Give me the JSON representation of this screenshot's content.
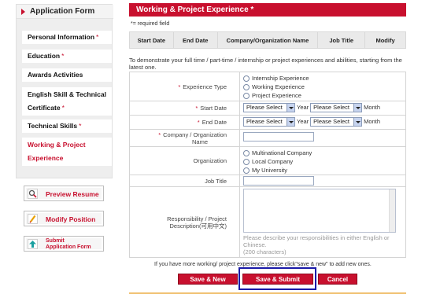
{
  "sidebar": {
    "title": "Application Form",
    "items": [
      {
        "label": "Personal Information",
        "required": "*"
      },
      {
        "label": "Education",
        "required": "*"
      },
      {
        "label": "Awards Activities",
        "required": ""
      },
      {
        "label_line1": "English Skill & Technical",
        "label_line2": "Certificate",
        "required": "*"
      },
      {
        "label": "Technical Skills",
        "required": "*"
      },
      {
        "label_line1": "Working & Project",
        "label_line2": "Experience",
        "active": true
      }
    ],
    "actions": [
      {
        "label": "Preview Resume",
        "icon": "magnifier-icon"
      },
      {
        "label": "Modify Position",
        "icon": "pencil-icon"
      },
      {
        "label_line1": "Submit",
        "label_line2": "Application Form",
        "icon": "upload-arrow-icon"
      }
    ]
  },
  "section": {
    "title": "Working & Project Experience *",
    "required_note": "*= required field",
    "table_headers": [
      "Start Date",
      "End Date",
      "Company/Organization Name",
      "Job Title",
      "Modify"
    ],
    "intro": "To demonstrate your full time / part-time / internship or project experiences and abilities, starting from the latest one."
  },
  "form": {
    "experience_type": {
      "label": "Experience Type",
      "options": [
        "Internship Experience",
        "Working Experience",
        "Project Experience"
      ]
    },
    "start_date": {
      "label": "Start Date",
      "year_value": "Please Select",
      "year_label": "Year",
      "month_value": "Please Select",
      "month_label": "Month"
    },
    "end_date": {
      "label": "End Date",
      "year_value": "Please Select",
      "year_label": "Year",
      "month_value": "Please Select",
      "month_label": "Month"
    },
    "company": {
      "label_line1": "Company / Organization",
      "label_line2": "Name",
      "value": ""
    },
    "organization": {
      "label": "Organization",
      "options": [
        "Multinational Company",
        "Local Company",
        "My University"
      ]
    },
    "job_title": {
      "label": "Job Title",
      "value": ""
    },
    "responsibility": {
      "label_line1": "Responsibility / Project",
      "label_line2": "Description(可用中文)",
      "hint_line1": "Please describe your responsibilities in either English or",
      "hint_line2": "Chinese.",
      "hint_line3": "(200 characters)"
    }
  },
  "footer": {
    "note": "If you have more working/ project experience, please click\"save & new\" to add new ones.",
    "save_new": "Save & New",
    "save_submit": "Save & Submit",
    "cancel": "Cancel"
  },
  "colors": {
    "accent": "#c8102e",
    "focus": "#1a1aa8"
  }
}
